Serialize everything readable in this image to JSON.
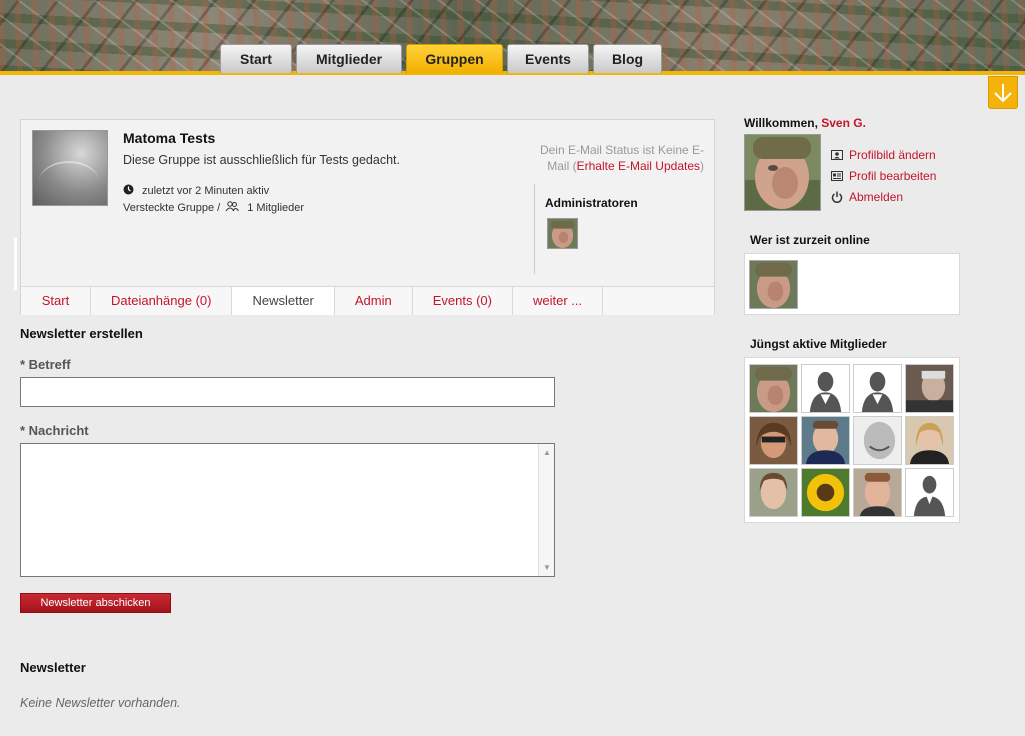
{
  "nav": {
    "items": [
      {
        "label": "Start"
      },
      {
        "label": "Mitglieder"
      },
      {
        "label": "Gruppen"
      },
      {
        "label": "Events"
      },
      {
        "label": "Blog"
      }
    ],
    "active": "Gruppen"
  },
  "group": {
    "name": "Matoma Tests",
    "description": "Diese Gruppe ist ausschließlich für Tests gedacht.",
    "last_active": "zuletzt vor 2 Minuten aktiv",
    "type": "Versteckte Gruppe /",
    "members": "1 Mitglieder",
    "email_status_prefix": "Dein E-Mail Status ist Keine E-Mail (",
    "email_status_link": "Erhalte E-Mail Updates",
    "email_status_suffix": ")",
    "admins_title": "Administratoren"
  },
  "group_tabs": [
    {
      "label": "Start"
    },
    {
      "label": "Dateianhänge (0)"
    },
    {
      "label": "Newsletter"
    },
    {
      "label": "Admin"
    },
    {
      "label": "Events (0)"
    },
    {
      "label": "weiter ..."
    }
  ],
  "form": {
    "heading": "Newsletter erstellen",
    "subject_label": "* Betreff",
    "subject_value": "",
    "message_label": "* Nachricht",
    "message_value": "",
    "submit_label": "Newsletter abschicken"
  },
  "newsletter": {
    "heading": "Newsletter",
    "empty_text": "Keine Newsletter vorhanden."
  },
  "sidebar": {
    "welcome_prefix": "Willkommen,",
    "user_name": "Sven G.",
    "links": [
      {
        "label": "Profilbild ändern",
        "icon": "id-card-icon"
      },
      {
        "label": "Profil bearbeiten",
        "icon": "profile-edit-icon"
      },
      {
        "label": "Abmelden",
        "icon": "power-icon"
      }
    ],
    "online_title": "Wer ist zurzeit online",
    "recent_title": "Jüngst aktive Mitglieder"
  },
  "colors": {
    "accent": "#f2b705",
    "link": "#c2152b",
    "button": "#b01c24"
  }
}
